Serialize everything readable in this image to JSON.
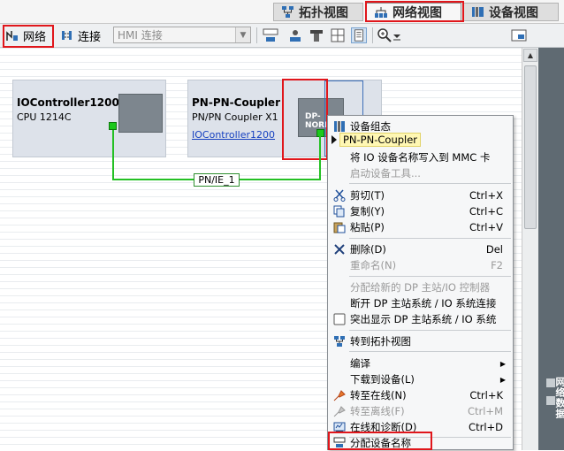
{
  "view_tabs": {
    "topology": "拓扑视图",
    "network": "网络视图",
    "device": "设备视图"
  },
  "toolbar": {
    "network_label": "网络",
    "connections_label": "连接",
    "hmi_select_value": "HMI 连接"
  },
  "devices": [
    {
      "name": "IOController1200",
      "type": "CPU 1214C"
    },
    {
      "name": "PN-PN-Coupler",
      "type": "PN/PN Coupler X1",
      "link": "IOController1200",
      "module_label": "DP-NORM"
    }
  ],
  "subnet_label": "PN/IE_1",
  "side_panel_label": "网络数据",
  "context_menu": [
    {
      "label": "设备组态",
      "icon": "device-config-icon"
    },
    {
      "label": "PN-PN-Coupler",
      "highlighted": true
    },
    {
      "label": "将 IO 设备名称写入到 MMC 卡"
    },
    {
      "label": "启动设备工具...",
      "disabled": true
    },
    {
      "label": "剪切(T)",
      "shortcut": "Ctrl+X",
      "icon": "cut-icon"
    },
    {
      "label": "复制(Y)",
      "shortcut": "Ctrl+C",
      "icon": "copy-icon"
    },
    {
      "label": "粘贴(P)",
      "shortcut": "Ctrl+V",
      "icon": "paste-icon"
    },
    {
      "label": "删除(D)",
      "shortcut": "Del",
      "icon": "delete-icon"
    },
    {
      "label": "重命名(N)",
      "shortcut": "F2",
      "disabled": true
    },
    {
      "label": "分配给新的 DP 主站/IO 控制器",
      "disabled": true
    },
    {
      "label": "断开 DP 主站系统 / IO 系统连接"
    },
    {
      "label": "突出显示 DP 主站系统 / IO 系统",
      "icon": "checkbox-icon"
    },
    {
      "label": "转到拓扑视图",
      "icon": "topology-view-icon"
    },
    {
      "label": "编译",
      "submenu": true
    },
    {
      "label": "下载到设备(L)",
      "submenu": true
    },
    {
      "label": "转至在线(N)",
      "shortcut": "Ctrl+K",
      "icon": "go-online-icon"
    },
    {
      "label": "转至离线(F)",
      "shortcut": "Ctrl+M",
      "icon": "go-offline-icon",
      "disabled": true
    },
    {
      "label": "在线和诊断(D)",
      "shortcut": "Ctrl+D",
      "icon": "online-diagnostics-icon"
    },
    {
      "label": "分配设备名称",
      "icon": "assign-name-icon"
    }
  ]
}
